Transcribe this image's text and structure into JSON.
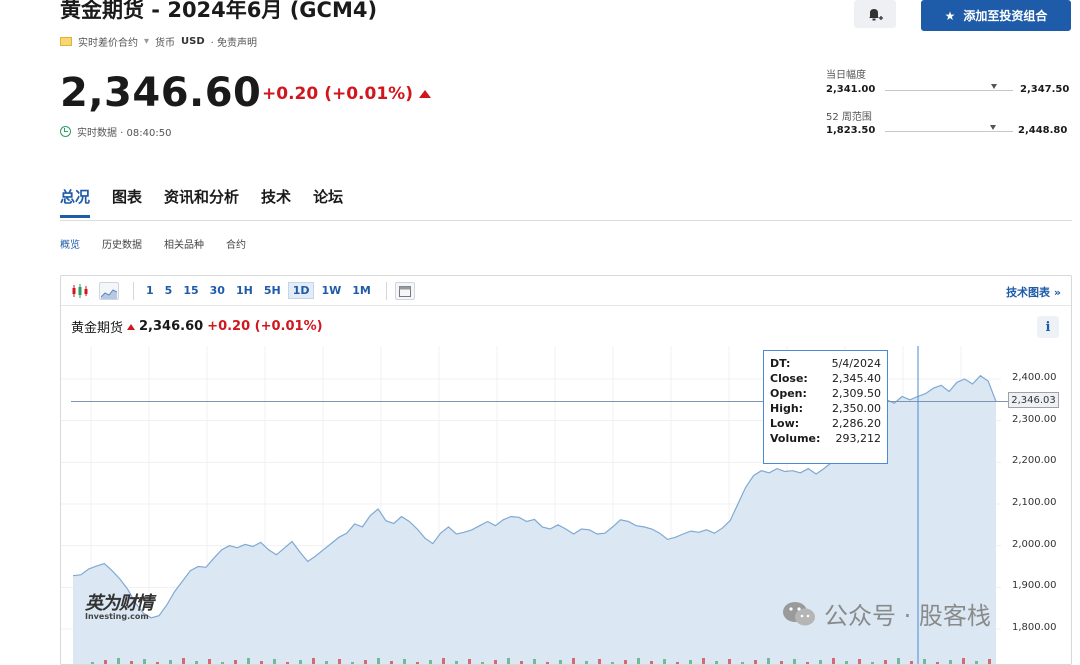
{
  "header": {
    "title": "黄金期货 - 2024年6月 (GCM4)",
    "add_button_label": "添加至投资组合",
    "contract_type": "实时差价合约",
    "currency_label": "货币",
    "currency": "USD",
    "disclaimer": "· 免责声明"
  },
  "quote": {
    "price": "2,346.60",
    "change": "+0.20",
    "change_pct": "(+0.01%)",
    "realtime_label": "实时数据 · 08:40:50"
  },
  "ranges": {
    "day_label": "当日幅度",
    "day_low": "2,341.00",
    "day_high": "2,347.50",
    "day_marker": 0.85,
    "week52_label": "52 周范围",
    "week52_low": "1,823.50",
    "week52_high": "2,448.80",
    "week52_marker": 0.84
  },
  "tabs": [
    "总况",
    "图表",
    "资讯和分析",
    "技术",
    "论坛"
  ],
  "subtabs": [
    "概览",
    "历史数据",
    "相关品种",
    "合约"
  ],
  "toolbar": {
    "timeframes": [
      "1",
      "5",
      "15",
      "30",
      "1H",
      "5H",
      "1D",
      "1W",
      "1M"
    ],
    "active_timeframe": "1D",
    "tech_chart_link": "技术图表 »"
  },
  "chart_header": {
    "name": "黄金期货",
    "price": "2,346.60",
    "change": "+0.20 (+0.01%)",
    "info": "i"
  },
  "tooltip": {
    "rows": [
      {
        "k": "DT:",
        "v": "5/4/2024"
      },
      {
        "k": "Close:",
        "v": "2,345.40"
      },
      {
        "k": "Open:",
        "v": "2,309.50"
      },
      {
        "k": "High:",
        "v": "2,350.00"
      },
      {
        "k": "Low:",
        "v": "2,286.20"
      },
      {
        "k": "Volume:",
        "v": "293,212"
      }
    ]
  },
  "price_tag": "2,346.03",
  "watermarks": {
    "left_cn": "英为财情",
    "left_en": "Investing.com",
    "right": "公众号 · 股客栈"
  },
  "colors": {
    "accent": "#1e5ba8",
    "up": "#d1161d",
    "area_fill": "#dbe8f4",
    "area_line": "#7fa9d3"
  },
  "chart_data": {
    "type": "area",
    "ylim": [
      1750,
      2450
    ],
    "yticks": [
      "2,400.00",
      "2,300.00",
      "2,200.00",
      "2,100.00",
      "2,000.00",
      "1,900.00",
      "1,800.00"
    ],
    "ytick_values": [
      2400,
      2300,
      2200,
      2100,
      2000,
      1900,
      1800
    ],
    "current": 2346.03,
    "values": [
      1928,
      1930,
      1944,
      1951,
      1957,
      1940,
      1920,
      1895,
      1862,
      1838,
      1827,
      1832,
      1858,
      1890,
      1915,
      1940,
      1950,
      1948,
      1970,
      1990,
      2000,
      1995,
      2003,
      1998,
      2008,
      1990,
      1978,
      1994,
      2010,
      1985,
      1962,
      1975,
      1990,
      2005,
      2020,
      2030,
      2052,
      2045,
      2072,
      2088,
      2060,
      2053,
      2070,
      2058,
      2040,
      2018,
      2005,
      2030,
      2045,
      2028,
      2032,
      2038,
      2048,
      2058,
      2048,
      2062,
      2070,
      2068,
      2058,
      2063,
      2045,
      2040,
      2050,
      2040,
      2028,
      2040,
      2038,
      2028,
      2030,
      2045,
      2062,
      2058,
      2048,
      2045,
      2040,
      2030,
      2015,
      2020,
      2028,
      2035,
      2032,
      2038,
      2030,
      2042,
      2060,
      2100,
      2140,
      2168,
      2180,
      2175,
      2185,
      2178,
      2180,
      2175,
      2185,
      2172,
      2185,
      2200,
      2225,
      2250,
      2285,
      2305,
      2330,
      2345,
      2350,
      2342,
      2358,
      2350,
      2358,
      2365,
      2378,
      2385,
      2370,
      2392,
      2400,
      2388,
      2408,
      2395,
      2346
    ]
  }
}
